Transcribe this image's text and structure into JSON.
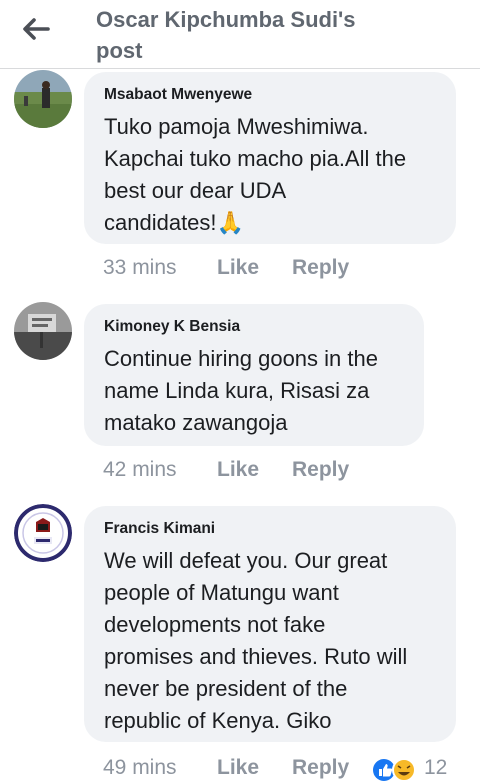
{
  "header": {
    "title_line1": "Oscar Kipchumba Sudi's",
    "title_line2": "post"
  },
  "comments": [
    {
      "author": "Msabaot Mwenyewe",
      "lines": [
        "Tuko pamoja Mweshimiwa.",
        "Kapchai tuko macho pia.All the",
        "best our dear UDA",
        "candidates!"
      ],
      "emoji": "🙏",
      "time": "33 mins",
      "like": "Like",
      "reply": "Reply"
    },
    {
      "author": "Kimoney K Bensia",
      "lines": [
        "Continue hiring goons in the",
        "name Linda kura, Risasi za",
        "matako zawangoja"
      ],
      "time": "42 mins",
      "like": "Like",
      "reply": "Reply"
    },
    {
      "author": "Francis Kimani",
      "lines": [
        "We will defeat you. Our great",
        "people of Matungu want",
        "developments not fake",
        "promises and thieves. Ruto will",
        "never be president of the",
        "republic of Kenya. Giko"
      ],
      "time": "49 mins",
      "like": "Like",
      "reply": "Reply",
      "reaction_count": "12"
    }
  ],
  "colors": {
    "bubble": "#f0f2f5",
    "meta": "#8d949e",
    "title": "#606770",
    "like_blue": "#1877f2",
    "haha_yellow": "#f7b928"
  },
  "icons": {
    "back": "arrow-left-icon",
    "like_reaction": "thumbs-up-icon",
    "haha_reaction": "laughing-face-icon"
  }
}
